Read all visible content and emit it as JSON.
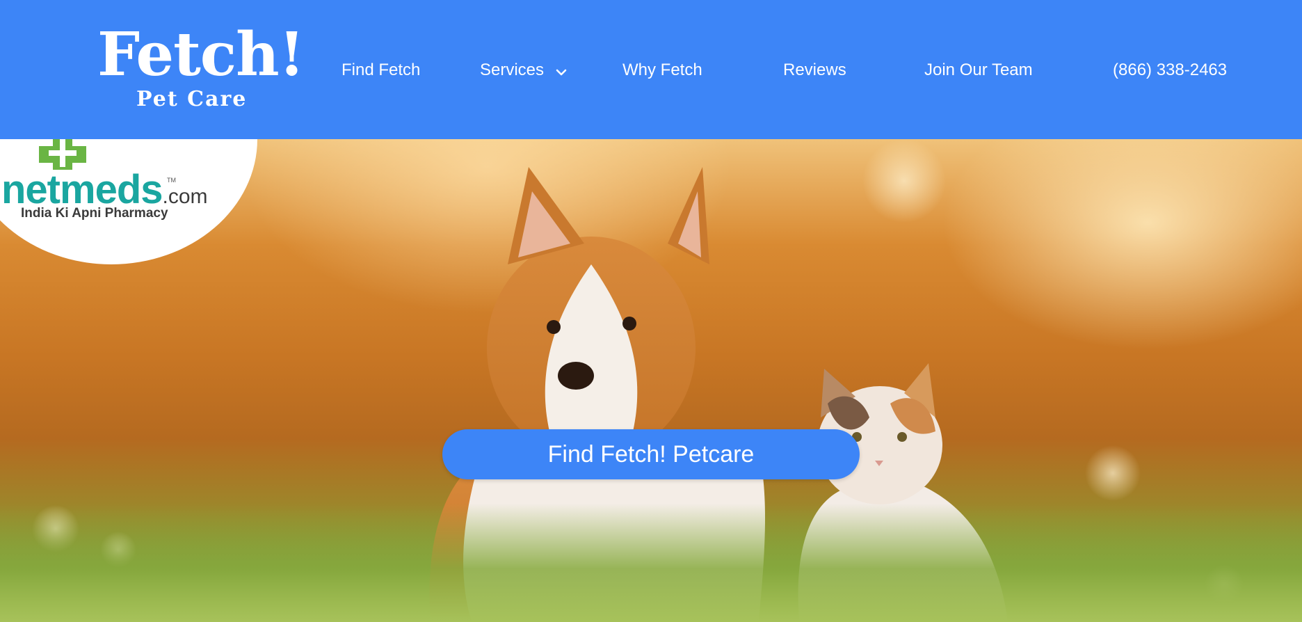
{
  "header": {
    "logo": {
      "main": "Fetch!",
      "sub": "Pet Care"
    },
    "nav": {
      "find": "Find Fetch",
      "services": "Services",
      "why": "Why Fetch",
      "reviews": "Reviews",
      "join": "Join Our Team",
      "phone": "(866) 338-2463"
    }
  },
  "badge": {
    "brand": "netmeds",
    "tld": ".com",
    "tm": "TM",
    "tagline": "India Ki Apni Pharmacy"
  },
  "hero": {
    "cta_label": "Find Fetch! Petcare",
    "image": "corgi-and-calico-cat-on-sunlit-grass"
  },
  "colors": {
    "brand_blue": "#3d85f7",
    "white": "#ffffff",
    "netmeds_teal": "#1aa6a0",
    "netmeds_green": "#6ab544"
  },
  "icons": {
    "services_dropdown": "chevron-down-icon",
    "badge_cross": "plus-icon"
  }
}
